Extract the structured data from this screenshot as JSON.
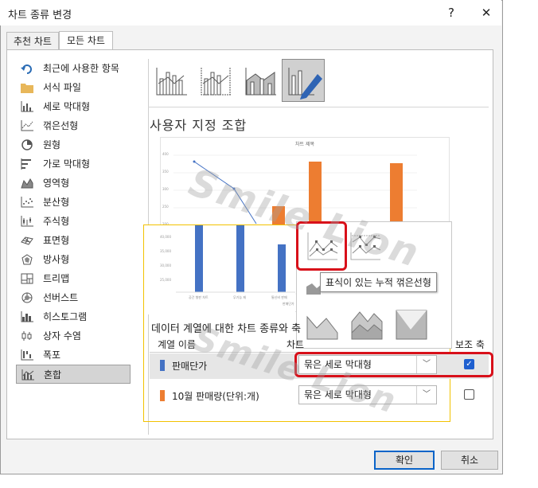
{
  "dialog": {
    "title": "차트 종류 변경",
    "help": "?",
    "close": "✕"
  },
  "tabs": [
    {
      "label": "추천 차트",
      "active": false
    },
    {
      "label": "모든 차트",
      "active": true
    }
  ],
  "sidebar": {
    "items": [
      {
        "label": "최근에 사용한 항목",
        "icon": "recent-icon"
      },
      {
        "label": "서식 파일",
        "icon": "folder-icon"
      },
      {
        "label": "세로 막대형",
        "icon": "column-chart-icon"
      },
      {
        "label": "꺾은선형",
        "icon": "line-chart-icon"
      },
      {
        "label": "원형",
        "icon": "pie-chart-icon"
      },
      {
        "label": "가로 막대형",
        "icon": "bar-chart-icon"
      },
      {
        "label": "영역형",
        "icon": "area-chart-icon"
      },
      {
        "label": "분산형",
        "icon": "scatter-chart-icon"
      },
      {
        "label": "주식형",
        "icon": "stock-chart-icon"
      },
      {
        "label": "표면형",
        "icon": "surface-chart-icon"
      },
      {
        "label": "방사형",
        "icon": "radar-chart-icon"
      },
      {
        "label": "트리맵",
        "icon": "treemap-icon"
      },
      {
        "label": "선버스트",
        "icon": "sunburst-icon"
      },
      {
        "label": "히스토그램",
        "icon": "histogram-icon"
      },
      {
        "label": "상자 수염",
        "icon": "box-whisker-icon"
      },
      {
        "label": "폭포",
        "icon": "waterfall-icon"
      },
      {
        "label": "혼합",
        "icon": "combo-chart-icon",
        "selected": true
      }
    ]
  },
  "main": {
    "heading": "사용자 지정 조합",
    "preview_title": "차트 제목",
    "preview_categories": [
      "공간 형판 차트",
      "무기능 재",
      "통신비 판매",
      "1"
    ],
    "preview_legend": "판매단가",
    "tooltip": "표식이 있는 누적 꺾은선형",
    "hidden_label": "영역형"
  },
  "series_section": {
    "label": "데이터 계열에 대한 차트 종류와 축",
    "col_name": "계열 이름",
    "col_type": "차트",
    "col_axis": "보조 축",
    "rows": [
      {
        "name": "판매단가",
        "color": "#4472c4",
        "type": "묶은 세로 막대형",
        "secondary": true
      },
      {
        "name": "10월 판매량(단위:개)",
        "color": "#ed7d31",
        "type": "묶은 세로 막대형",
        "secondary": false
      }
    ]
  },
  "buttons": {
    "ok": "확인",
    "cancel": "취소"
  },
  "watermark": "Smile Lion"
}
